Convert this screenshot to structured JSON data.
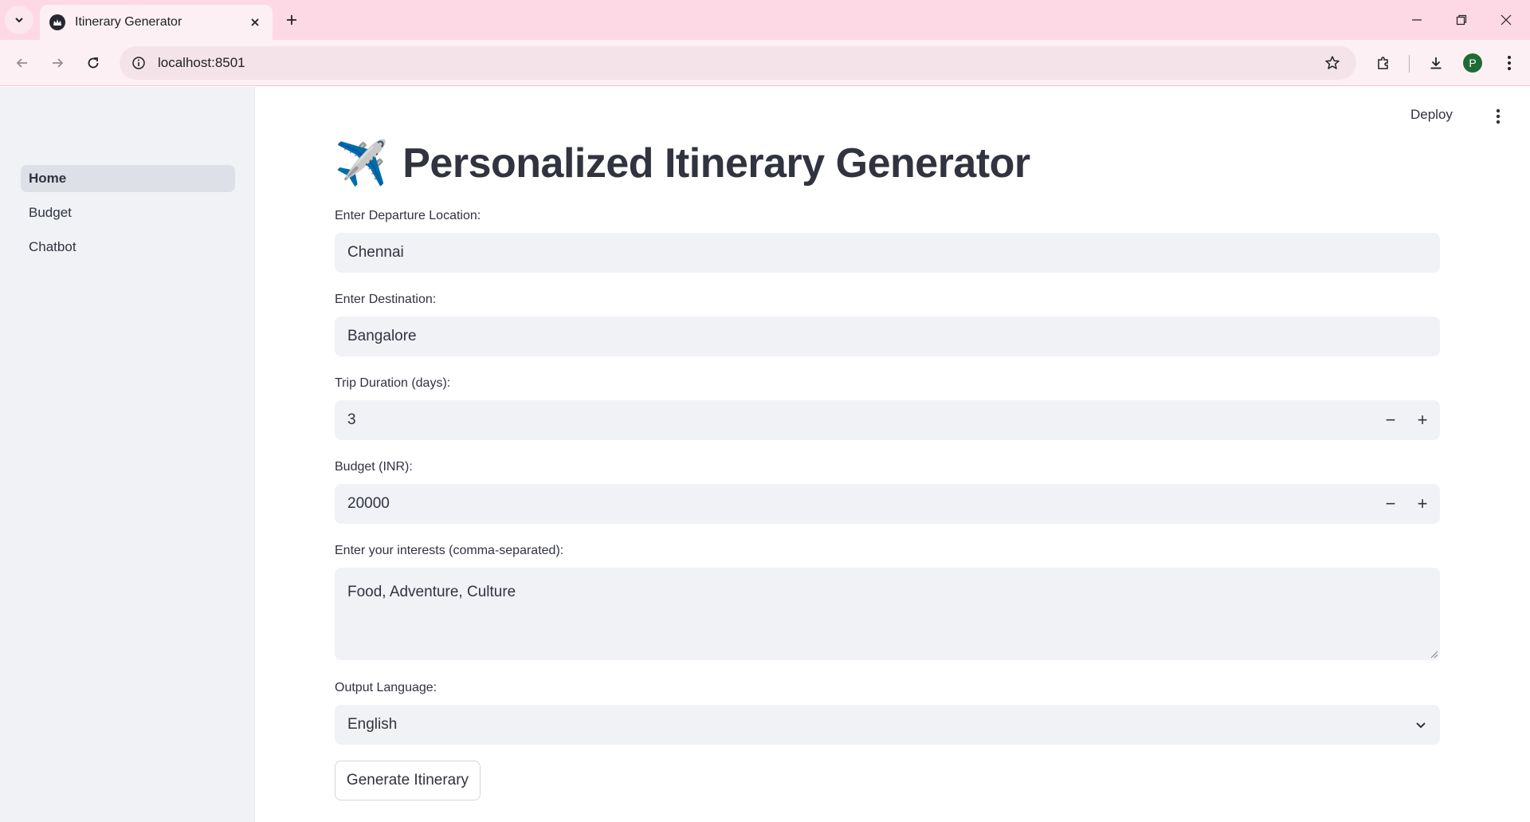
{
  "browser": {
    "tab_title": "Itinerary Generator",
    "url": "localhost:8501",
    "profile_initial": "P"
  },
  "app": {
    "deploy_label": "Deploy",
    "title_emoji": "✈️",
    "title": "Personalized Itinerary Generator"
  },
  "sidebar": {
    "items": [
      {
        "label": "Home",
        "active": true
      },
      {
        "label": "Budget",
        "active": false
      },
      {
        "label": "Chatbot",
        "active": false
      }
    ]
  },
  "form": {
    "departure": {
      "label": "Enter Departure Location:",
      "value": "Chennai"
    },
    "destination": {
      "label": "Enter Destination:",
      "value": "Bangalore"
    },
    "duration": {
      "label": "Trip Duration (days):",
      "value": "3",
      "minus": "−",
      "plus": "+"
    },
    "budget": {
      "label": "Budget (INR):",
      "value": "20000",
      "minus": "−",
      "plus": "+"
    },
    "interests": {
      "label": "Enter your interests (comma-separated):",
      "value": "Food, Adventure, Culture"
    },
    "language": {
      "label": "Output Language:",
      "value": "English"
    },
    "submit_label": "Generate Itinerary"
  },
  "colors": {
    "tabbar": "#fcd9e4",
    "toolbar": "#fdf0f4",
    "sidebar": "#f0f2f6",
    "input_bg": "#f0f2f6",
    "text": "#31333f"
  }
}
